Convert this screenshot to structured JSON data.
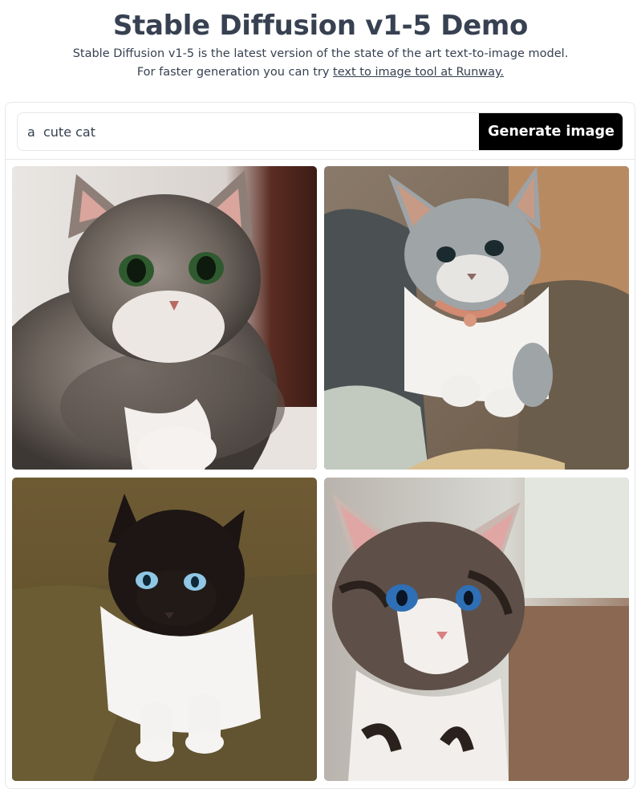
{
  "header": {
    "title": "Stable Diffusion v1-5 Demo",
    "subtitle_line1": "Stable Diffusion v1-5 is the latest version of the state of the art text-to-image model.",
    "subtitle_line2_prefix": "For faster generation you can try ",
    "subtitle_link": "text to image tool at Runway."
  },
  "prompt": {
    "value": "a  cute cat",
    "button_label": "Generate image"
  },
  "gallery": {
    "images": [
      {
        "subject": "tabby-kitten-green-eyes"
      },
      {
        "subject": "grey-white-kitten-collar"
      },
      {
        "subject": "black-white-cat-blue-eyes"
      },
      {
        "subject": "tabby-white-kitten-blue-eyes"
      }
    ]
  },
  "colors": {
    "title": "#374151",
    "button_bg": "#000000",
    "button_text": "#ffffff",
    "border": "#e5e7eb"
  }
}
